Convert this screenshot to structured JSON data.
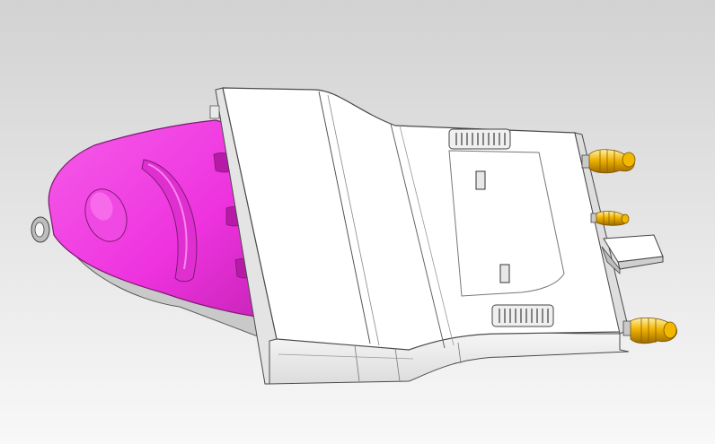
{
  "viewport": {
    "background_top": "#d2d2d2",
    "background_bottom": "#f8f8f8"
  },
  "model": {
    "body": {
      "color": "#ffffff",
      "edge_color": "#4a4a4a"
    },
    "cap": {
      "color": "#f03ae0",
      "edge_color": "#7d1b72",
      "shade_color": "#d42dc5"
    },
    "pins": {
      "color": "#e6a800",
      "highlight_color": "#fff0a0",
      "count": 3
    },
    "blade": {
      "color": "#ffffff"
    },
    "grips": {
      "count": 2
    },
    "slots": {
      "count": 2
    }
  }
}
